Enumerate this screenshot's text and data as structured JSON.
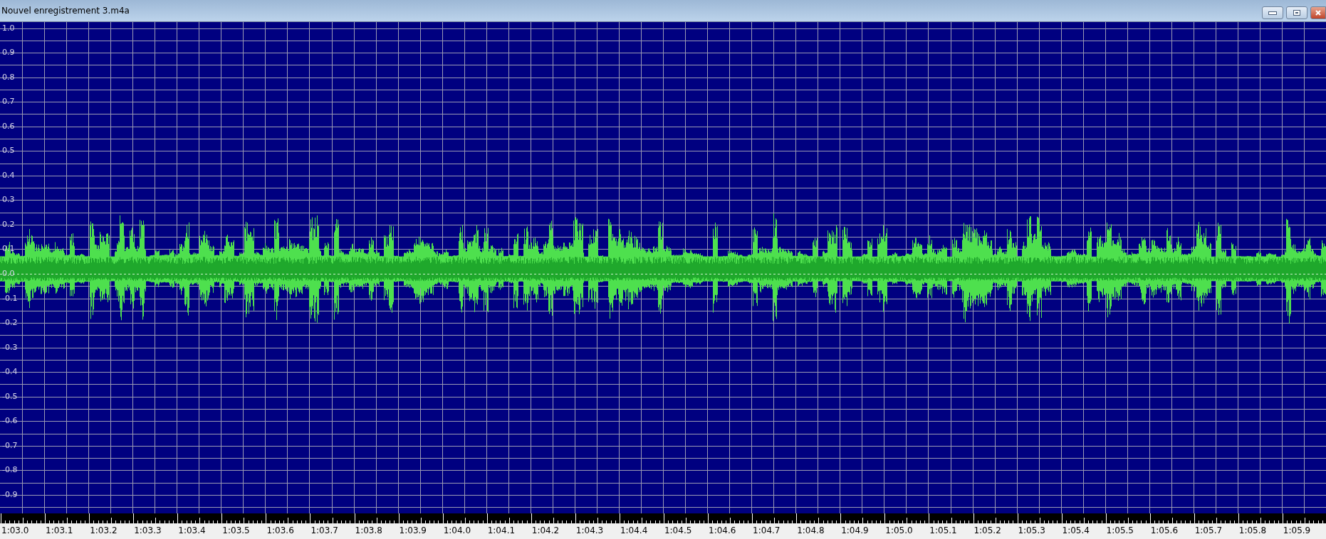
{
  "window": {
    "title": "Nouvel enregistrement 3.m4a"
  },
  "amplitude_axis": {
    "labels": [
      "1.0",
      "0.9",
      "0.8",
      "0.7",
      "0.6",
      "0.5",
      "0.4",
      "0.3",
      "0.2",
      "0.1",
      "0.0",
      "-0.1",
      "-0.2",
      "-0.3",
      "-0.4",
      "-0.5",
      "-0.6",
      "-0.7",
      "-0.8",
      "-0.9"
    ]
  },
  "time_axis": {
    "labels": [
      "1:03.0",
      "1:03.1",
      "1:03.2",
      "1:03.3",
      "1:03.4",
      "1:03.5",
      "1:03.6",
      "1:03.7",
      "1:03.8",
      "1:03.9",
      "1:04.0",
      "1:04.1",
      "1:04.2",
      "1:04.3",
      "1:04.4",
      "1:04.5",
      "1:04.6",
      "1:04.7",
      "1:04.8",
      "1:04.9",
      "1:05.0",
      "1:05.1",
      "1:05.2",
      "1:05.3",
      "1:05.4",
      "1:05.5",
      "1:05.6",
      "1:05.7",
      "1:05.8",
      "1:05.9"
    ]
  }
}
